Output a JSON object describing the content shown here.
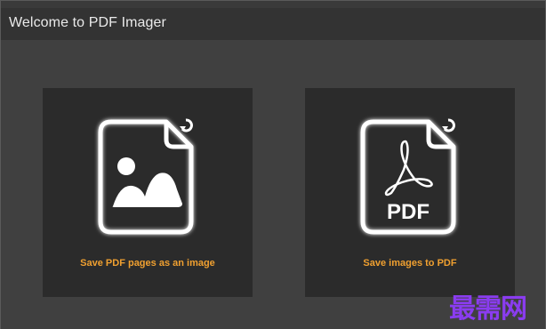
{
  "window": {
    "title": "Welcome to PDF Imager"
  },
  "cards": [
    {
      "label": "Save PDF pages as an image",
      "icon": "image-file-icon"
    },
    {
      "label": "Save images to PDF",
      "icon": "pdf-file-icon",
      "icon_text": "PDF"
    }
  ],
  "watermark": {
    "text": "最需网"
  },
  "colors": {
    "background": "#404040",
    "card": "#2b2b2b",
    "accent": "#f0a030",
    "watermark": "#8a3cf0"
  }
}
